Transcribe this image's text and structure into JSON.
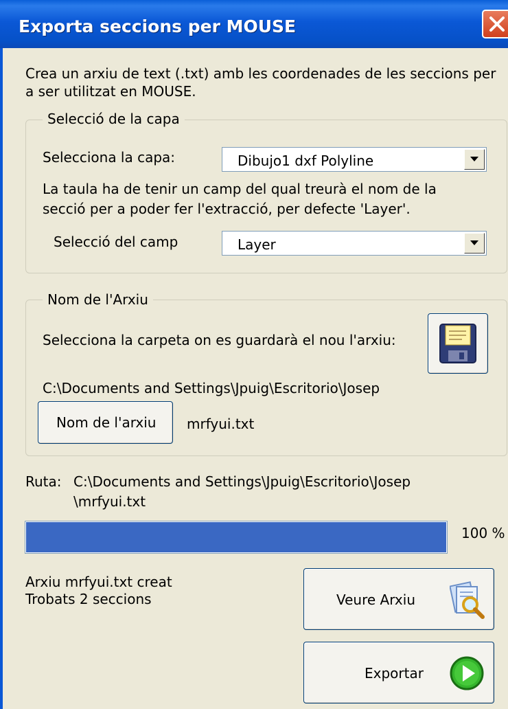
{
  "window": {
    "title": "Exporta seccions per MOUSE"
  },
  "description": {
    "line1": "Crea un arxiu de text (.txt) amb les coordenades de les seccions per",
    "line2": "a ser utilitzat en MOUSE."
  },
  "layer_group": {
    "legend": "Selecció de la capa",
    "select_layer_label": "Selecciona la capa:",
    "layer_value": "Dibujo1  dxf  Polyline",
    "note_line1": "La taula ha de tenir un camp del qual treurà el nom de la",
    "note_line2": "secció per a poder fer l'extracció, per defecte 'Layer'.",
    "field_label": "Selecció del camp",
    "field_value": "Layer"
  },
  "file_group": {
    "legend": "Nom de l'Arxiu",
    "folder_label": "Selecciona la carpeta on es guardarà el nou l'arxiu:",
    "folder_path": "C:\\Documents and Settings\\Jpuig\\Escritorio\\Josep",
    "name_button_label": "Nom de l'arxiu",
    "file_name": "mrfyui.txt"
  },
  "route": {
    "label": "Ruta:",
    "line1": "C:\\Documents and Settings\\Jpuig\\Escritorio\\Josep",
    "line2": "\\mrfyui.txt"
  },
  "progress": {
    "value": 100,
    "text": "100 %",
    "color": "#3a68c3"
  },
  "status": {
    "line1": "Arxiu mrfyui.txt creat",
    "line2": "Trobats 2 seccions"
  },
  "buttons": {
    "view_label": "Veure Arxiu",
    "export_label": "Exportar"
  },
  "icons": {
    "close": "close-icon",
    "floppy": "floppy-disk-icon",
    "view": "document-magnifier-icon",
    "export": "green-play-icon",
    "dropdown": "dropdown-arrow-icon"
  }
}
